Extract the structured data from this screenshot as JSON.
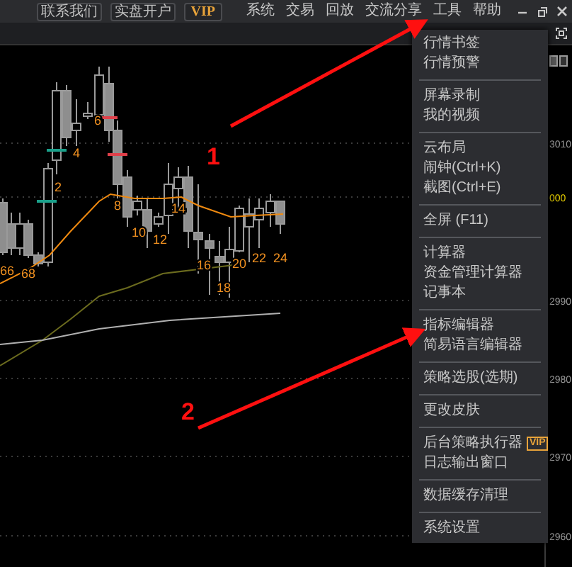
{
  "toolbar": {
    "buttons": [
      "联系我们",
      "实盘开户"
    ],
    "vip": "VIP"
  },
  "menu_bar": [
    "系统",
    "交易",
    "回放",
    "交流分享",
    "工具",
    "帮助"
  ],
  "chart": {
    "price_labels": [
      {
        "text": "3010",
        "kind": "normal"
      },
      {
        "text": "000",
        "kind": "current"
      },
      {
        "text": "2990",
        "kind": "normal"
      },
      {
        "text": "2980",
        "kind": "normal"
      },
      {
        "text": "2970",
        "kind": "normal"
      },
      {
        "text": "2960",
        "kind": "normal"
      }
    ],
    "candle_labels": [
      "66",
      "68",
      "2",
      "4",
      "6",
      "8",
      "10",
      "12",
      "14",
      "16",
      "18",
      "20",
      "22",
      "24"
    ]
  },
  "annotations": [
    "1",
    "2"
  ],
  "tools_menu": {
    "sections": [
      [
        {
          "label": "行情书签"
        },
        {
          "label": "行情预警"
        }
      ],
      [
        {
          "label": "屏幕录制"
        },
        {
          "label": "我的视频"
        }
      ],
      [
        {
          "label": "云布局"
        },
        {
          "label": "闹钟(Ctrl+K)"
        },
        {
          "label": "截图(Ctrl+E)"
        }
      ],
      [
        {
          "label": "全屏 (F11)"
        }
      ],
      [
        {
          "label": "计算器"
        },
        {
          "label": "资金管理计算器"
        },
        {
          "label": "记事本"
        }
      ],
      [
        {
          "label": "指标编辑器"
        },
        {
          "label": "简易语言编辑器"
        }
      ],
      [
        {
          "label": "策略选股(选期)"
        }
      ],
      [
        {
          "label": "更改皮肤"
        }
      ],
      [
        {
          "label": "后台策略执行器",
          "badge": "VIP"
        },
        {
          "label": "日志输出窗口"
        }
      ],
      [
        {
          "label": "数据缓存清理"
        }
      ],
      [
        {
          "label": "系统设置"
        }
      ]
    ]
  }
}
